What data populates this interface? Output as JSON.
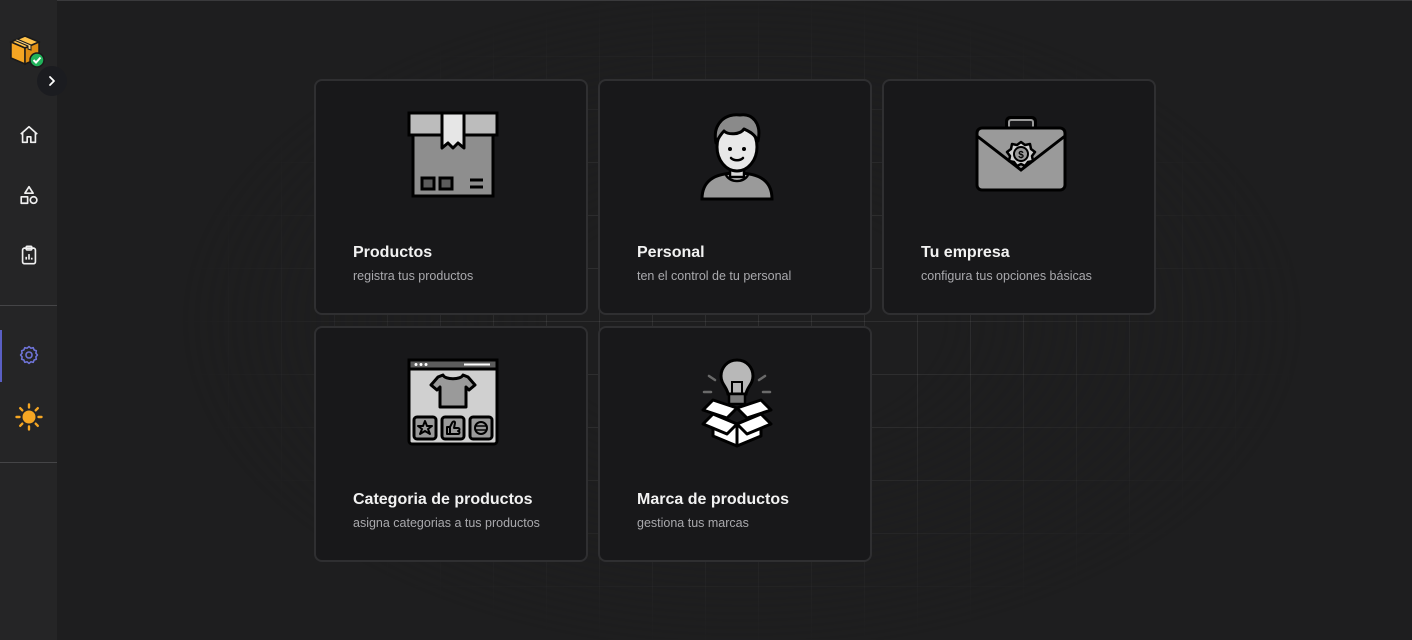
{
  "sidebar": {
    "logo": "package-check-logo",
    "toggle_icon": "chevron-right-icon",
    "items": [
      {
        "name": "home",
        "icon": "home-icon"
      },
      {
        "name": "shapes",
        "icon": "shapes-icon"
      },
      {
        "name": "reports",
        "icon": "clipboard-chart-icon"
      },
      {
        "name": "settings",
        "icon": "gear-icon",
        "active": true
      },
      {
        "name": "theme",
        "icon": "sun-icon"
      }
    ],
    "accent_color": "#5a5fc4",
    "sun_color": "#f5a623"
  },
  "cards": [
    {
      "title": "Productos",
      "subtitle": "registra tus productos",
      "icon": "box-icon"
    },
    {
      "title": "Personal",
      "subtitle": "ten el control de tu personal",
      "icon": "person-icon"
    },
    {
      "title": "Tu empresa",
      "subtitle": "configura tus opciones básicas",
      "icon": "briefcase-gear-icon"
    },
    {
      "title": "Categoria de productos",
      "subtitle": "asigna categorias a tus productos",
      "icon": "shop-window-tshirt-icon"
    },
    {
      "title": "Marca de productos",
      "subtitle": "gestiona tus marcas",
      "icon": "lightbulb-box-icon"
    }
  ]
}
